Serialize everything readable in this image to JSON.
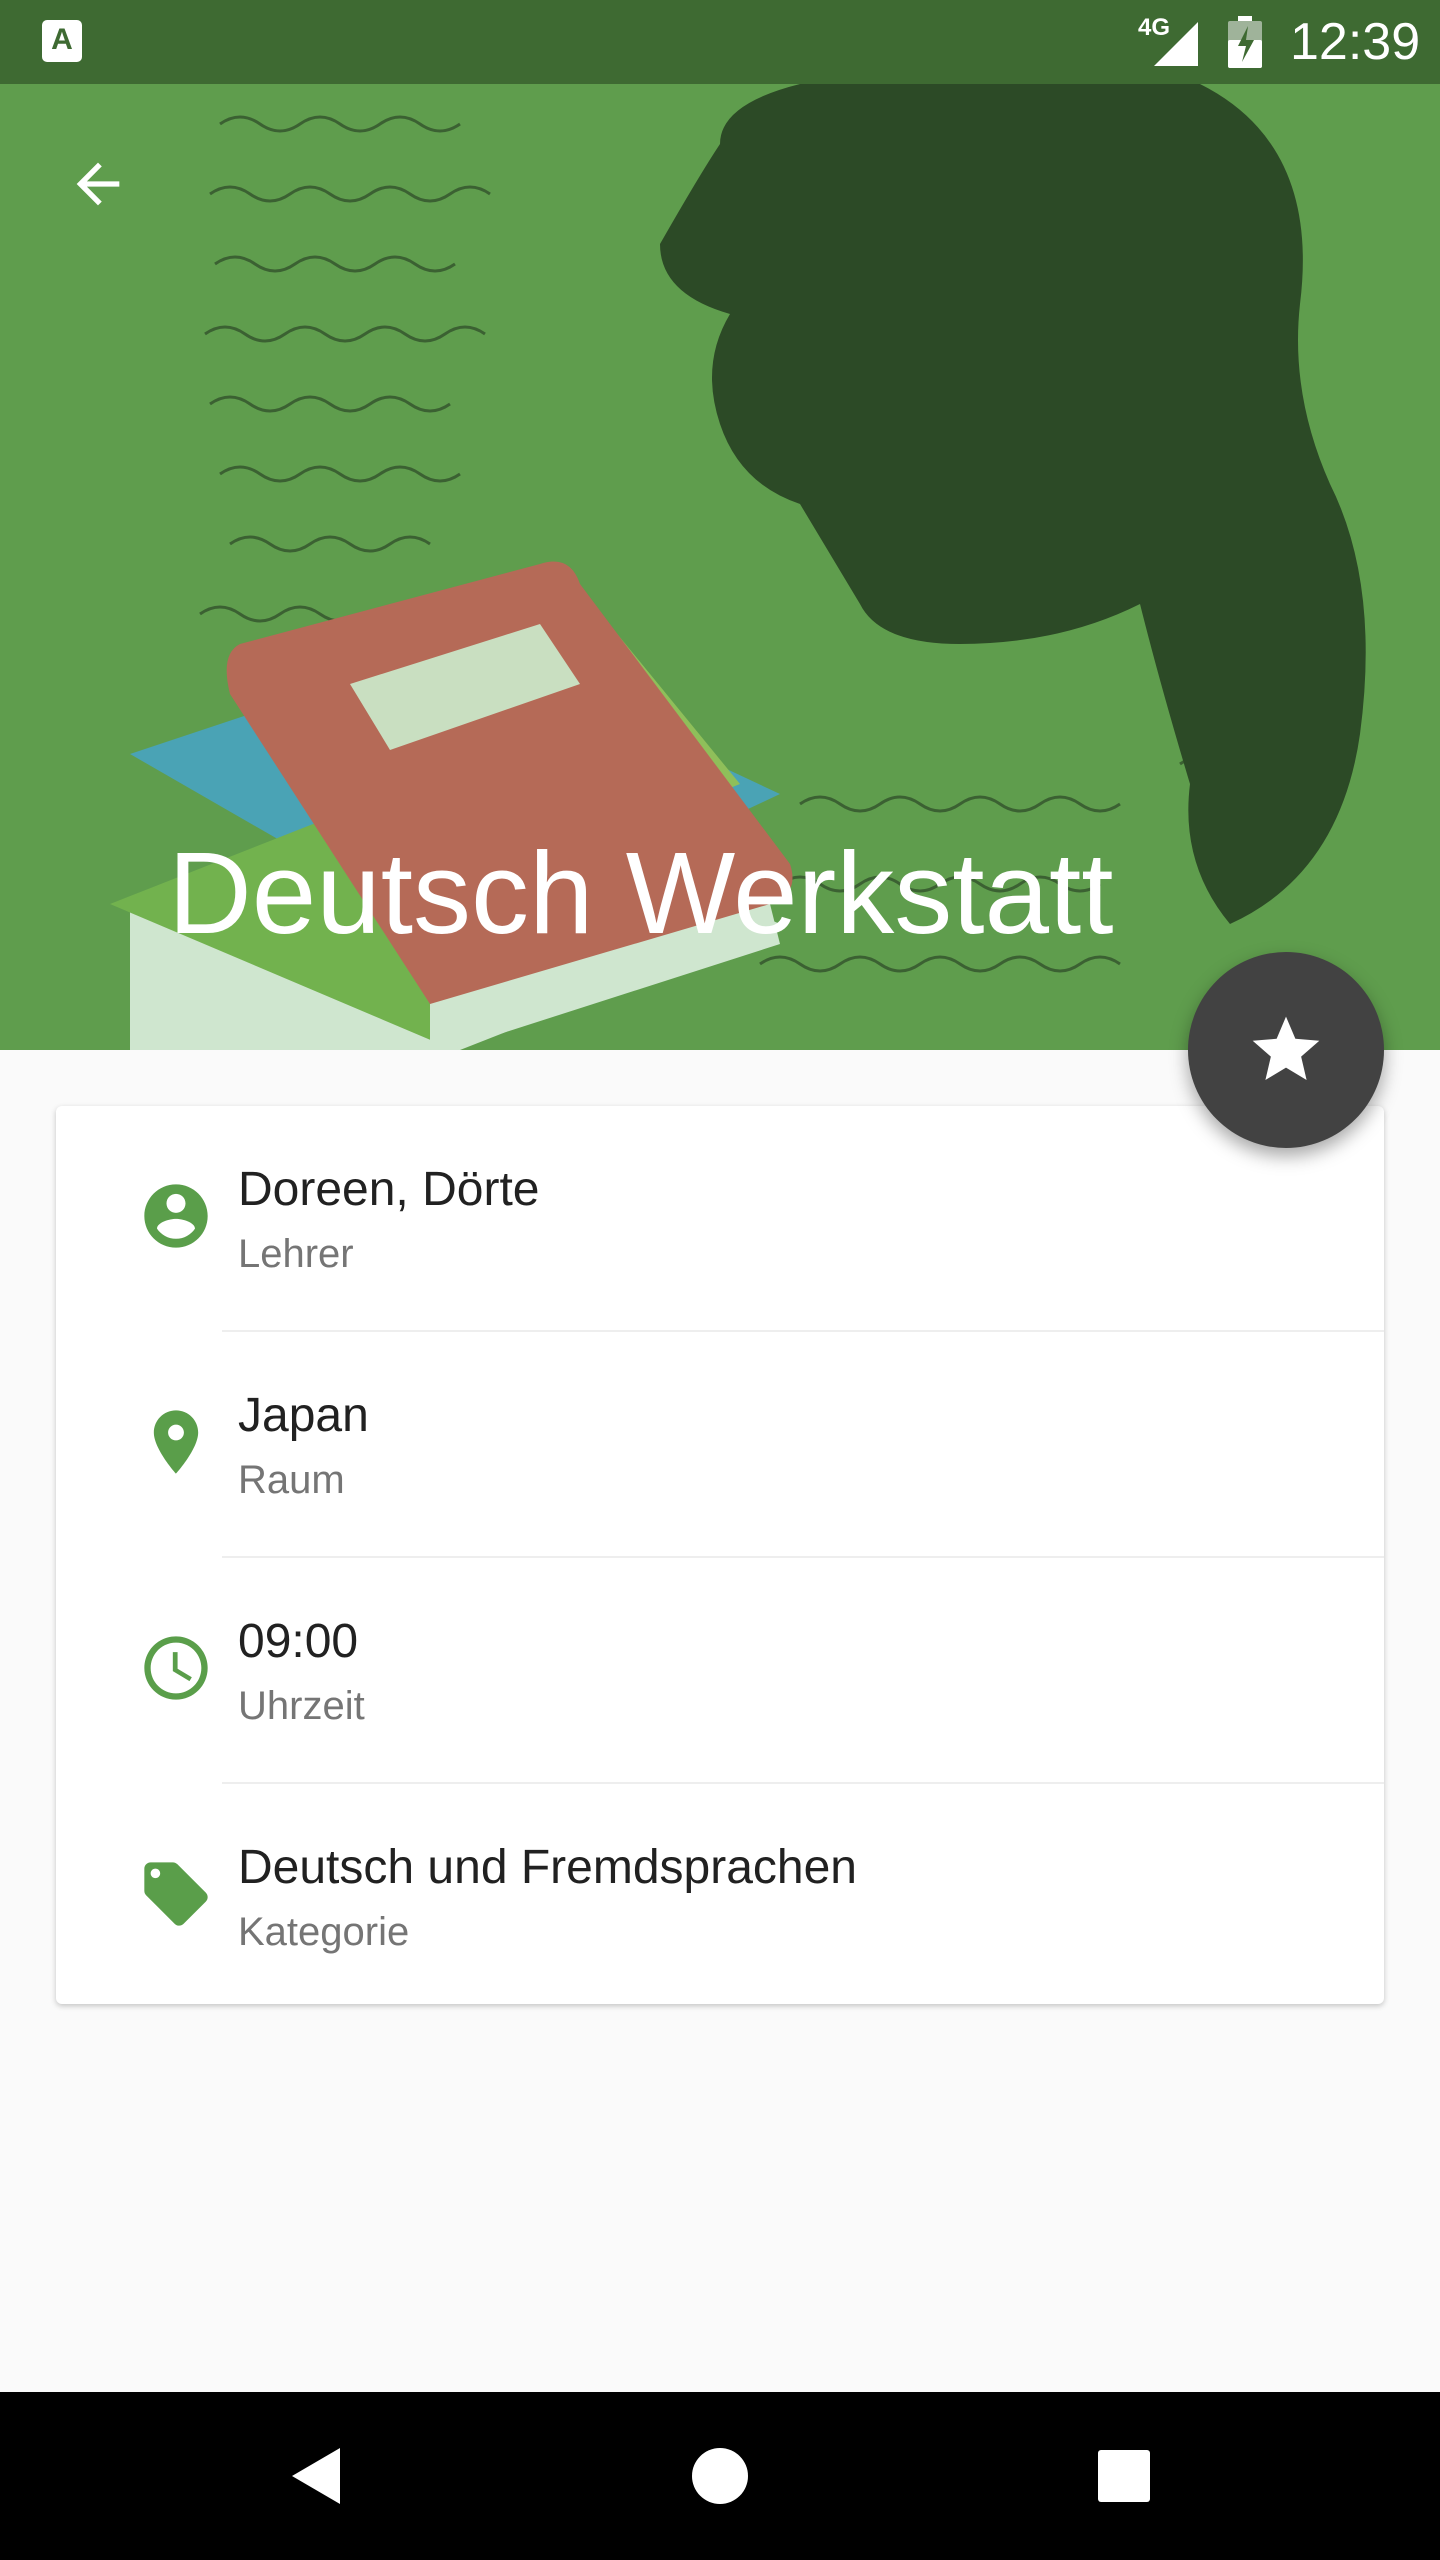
{
  "status_bar": {
    "network": "4G",
    "time": "12:39",
    "notification_icon": "A"
  },
  "header": {
    "title": "Deutsch Werkstatt",
    "back_icon": "arrow-back-icon",
    "background_color": "#5f9d4d"
  },
  "fab": {
    "icon": "star-icon",
    "color": "#424242"
  },
  "details": [
    {
      "icon": "person-icon",
      "value": "Doreen, Dörte",
      "label": "Lehrer"
    },
    {
      "icon": "location-pin-icon",
      "value": "Japan",
      "label": "Raum"
    },
    {
      "icon": "clock-icon",
      "value": "09:00",
      "label": "Uhrzeit"
    },
    {
      "icon": "tag-icon",
      "value": "Deutsch und Fremdsprachen",
      "label": "Kategorie"
    }
  ],
  "accent_color": "#5a9e4a",
  "nav_bar": {
    "back": "nav-back-icon",
    "home": "nav-home-icon",
    "recents": "nav-recents-icon"
  }
}
